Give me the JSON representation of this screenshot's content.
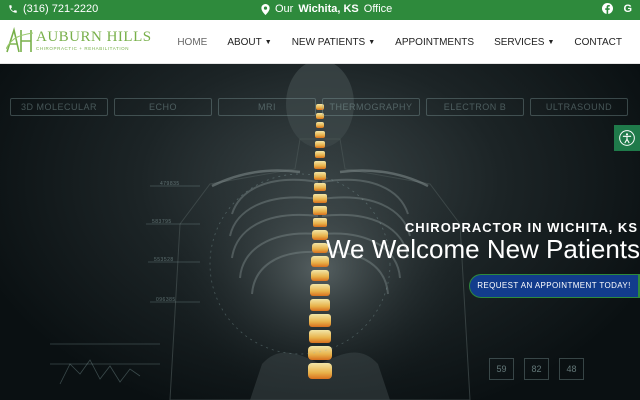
{
  "topbar": {
    "phone": "(316) 721-2220",
    "office_prefix": "Our",
    "office_city": "Wichita, KS",
    "office_suffix": "Office",
    "social": [
      "facebook-icon",
      "google-icon"
    ],
    "google_glyph": "G"
  },
  "logo": {
    "name": "AUBURN HILLS",
    "tagline": "CHIROPRACTIC + REHABILITATION"
  },
  "nav": {
    "items": [
      {
        "label": "HOME",
        "dropdown": false
      },
      {
        "label": "ABOUT",
        "dropdown": true
      },
      {
        "label": "NEW PATIENTS",
        "dropdown": true
      },
      {
        "label": "APPOINTMENTS",
        "dropdown": false
      },
      {
        "label": "SERVICES",
        "dropdown": true
      },
      {
        "label": "CONTACT",
        "dropdown": false
      }
    ]
  },
  "hero": {
    "imaging_tabs": [
      "3D MOLECULAR",
      "ECHO",
      "MRI",
      "THERMOGRAPHY",
      "ELECTRON B",
      "ULTRASOUND"
    ],
    "side_labels": [
      "479835",
      "583795",
      "553528",
      "096385"
    ],
    "subtitle": "CHIROPRACTOR IN WICHITA, KS",
    "title": "We Welcome New Patients",
    "cta_label": "REQUEST AN APPOINTMENT TODAY!",
    "readouts": [
      "59",
      "82",
      "48"
    ]
  },
  "colors": {
    "topbar": "#2e8a3c",
    "brand_green": "#78b04a",
    "cta_blue": "#123c8c",
    "accessibility": "#1f7a4a"
  }
}
